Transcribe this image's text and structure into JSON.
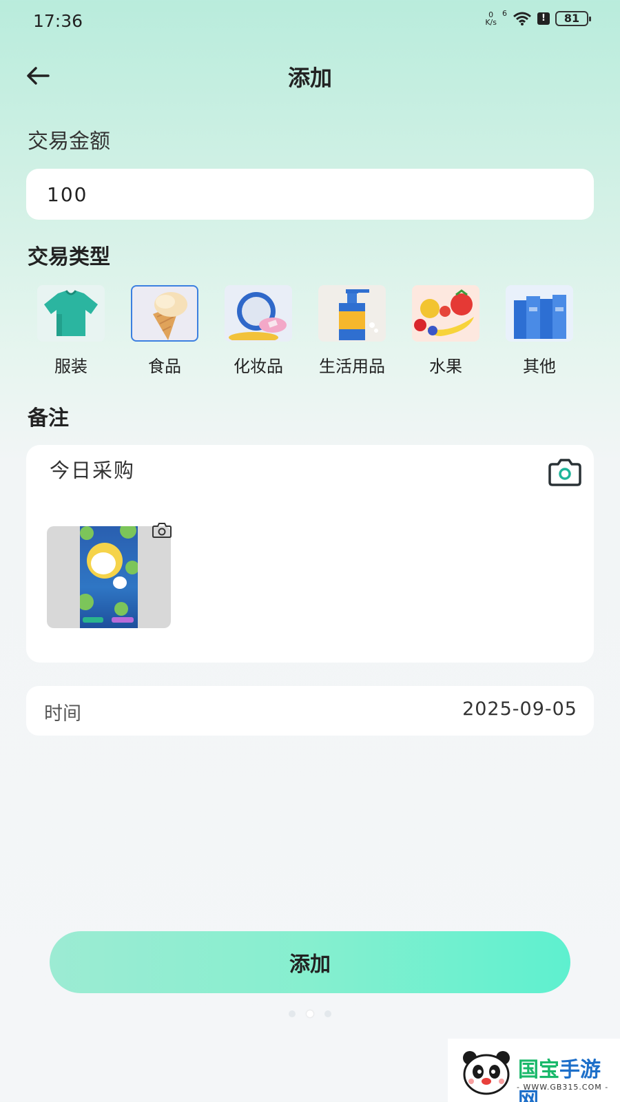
{
  "status_bar": {
    "time": "17:36",
    "net_speed_top": "0",
    "net_speed_bottom": "K/s",
    "signal": "6",
    "alert": "!",
    "battery": "81"
  },
  "header": {
    "title": "添加",
    "back_icon": "arrow-left-icon"
  },
  "form": {
    "amount_label": "交易金额",
    "amount_value": "100",
    "type_label": "交易类型",
    "categories": [
      {
        "label": "服装",
        "icon": "tshirt-icon",
        "selected": false
      },
      {
        "label": "食品",
        "icon": "ice-cream-icon",
        "selected": true
      },
      {
        "label": "化妆品",
        "icon": "mirror-icon",
        "selected": false
      },
      {
        "label": "生活用品",
        "icon": "pump-bottle-icon",
        "selected": false
      },
      {
        "label": "水果",
        "icon": "fruit-icon",
        "selected": false
      },
      {
        "label": "其他",
        "icon": "books-icon",
        "selected": false
      }
    ],
    "note_label": "备注",
    "note_text": "今日采购",
    "time_label": "时间",
    "time_value": "2025-09-05"
  },
  "submit_label": "添加",
  "watermark": {
    "title_part1": "国宝",
    "title_part2": "手游网",
    "subtitle": "- WWW.GB315.COM -"
  },
  "colors": {
    "accent_button": "#5ef0cf",
    "selected_border": "#3b7fe0",
    "header_gradient": "#b9ecdc"
  }
}
